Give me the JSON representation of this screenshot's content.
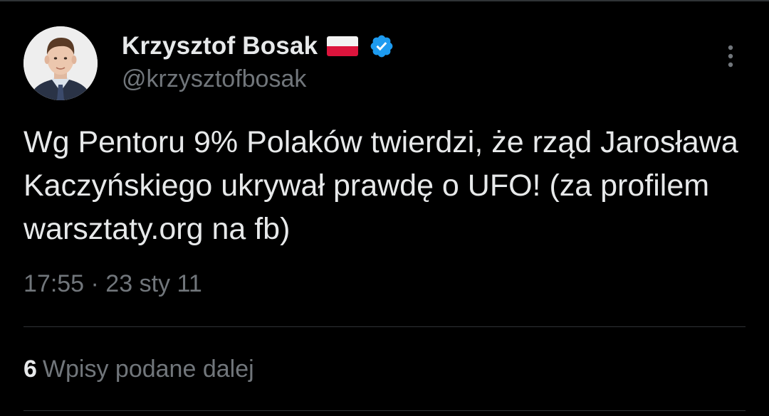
{
  "author": {
    "display_name": "Krzysztof Bosak",
    "handle": "@krzysztofbosak",
    "flag_icon": "poland-flag-icon",
    "verified_icon": "verified-badge-icon",
    "verified_color": "#1d9bf0"
  },
  "tweet": {
    "text": "Wg Pentoru 9% Polaków twierdzi, że rząd Jarosława Kaczyńskiego ukrywał prawdę o UFO! (za profilem warsztaty.org na fb)",
    "timestamp": "17:55 · 23 sty 11"
  },
  "stats": {
    "retweet_count": "6",
    "retweet_label": "Wpisy podane dalej"
  },
  "menu": {
    "more_icon": "more-vertical-icon"
  },
  "colors": {
    "background": "#000000",
    "text_primary": "#e7e9ea",
    "text_secondary": "#71767b",
    "divider": "#2f3336"
  }
}
